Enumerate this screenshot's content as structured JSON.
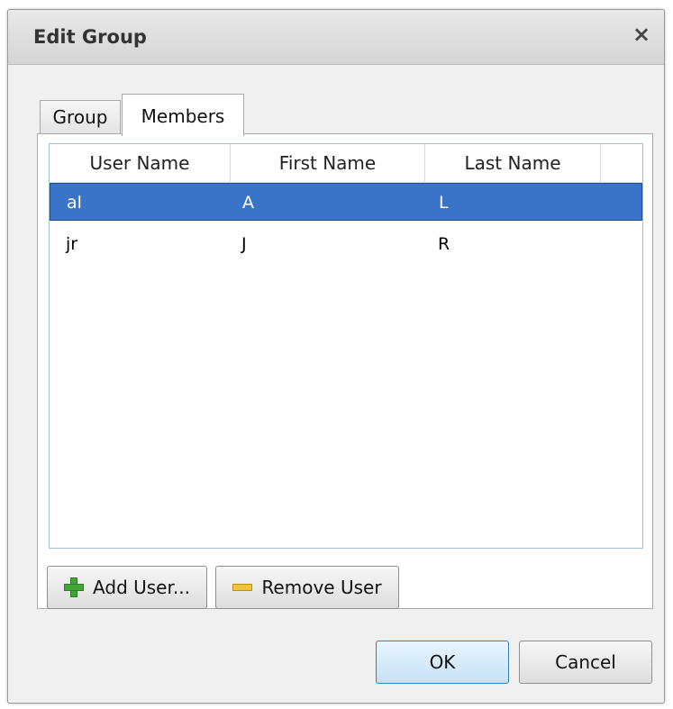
{
  "dialog": {
    "title": "Edit Group",
    "close_symbol": "×"
  },
  "tabs": [
    {
      "label": "Group",
      "active": false
    },
    {
      "label": "Members",
      "active": true
    }
  ],
  "table": {
    "columns": [
      "User Name",
      "First Name",
      "Last Name"
    ],
    "rows": [
      {
        "user_name": "al",
        "first_name": "A",
        "last_name": "L",
        "selected": true
      },
      {
        "user_name": "jr",
        "first_name": "J",
        "last_name": "R",
        "selected": false
      }
    ]
  },
  "panel_buttons": {
    "add_user": "Add User...",
    "remove_user": "Remove User"
  },
  "footer": {
    "ok": "OK",
    "cancel": "Cancel"
  },
  "icons": {
    "add": "plus-icon",
    "remove": "minus-icon",
    "close": "close-icon"
  },
  "colors": {
    "selection": "#3a74c8",
    "default_button": "#c4e2f7"
  }
}
